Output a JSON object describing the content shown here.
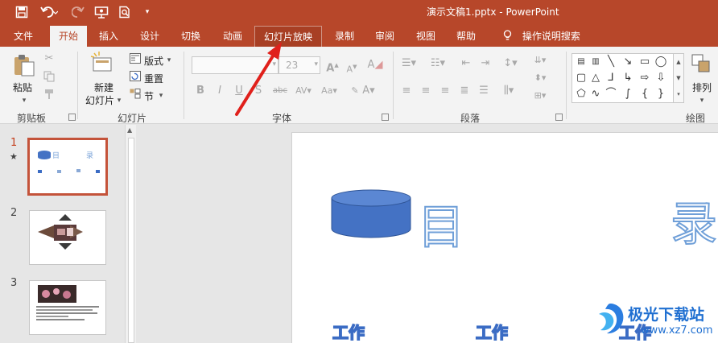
{
  "titlebar": {
    "document_title": "演示文稿1.pptx  -  PowerPoint",
    "quick_access": [
      "save-icon",
      "undo-icon",
      "redo-icon",
      "slideshow-from-start-icon",
      "print-preview-icon",
      "customize-qat-icon"
    ]
  },
  "tabs": [
    {
      "label": "文件"
    },
    {
      "label": "开始"
    },
    {
      "label": "插入"
    },
    {
      "label": "设计"
    },
    {
      "label": "切换"
    },
    {
      "label": "动画"
    },
    {
      "label": "幻灯片放映"
    },
    {
      "label": "录制"
    },
    {
      "label": "审阅"
    },
    {
      "label": "视图"
    },
    {
      "label": "帮助"
    },
    {
      "label": "操作说明搜索"
    }
  ],
  "ribbon": {
    "clipboard": {
      "paste": "粘贴",
      "group": "剪贴板"
    },
    "slides": {
      "new_slide_1": "新建",
      "new_slide_2": "幻灯片",
      "layout": "版式",
      "reset": "重置",
      "section": "节",
      "group": "幻灯片"
    },
    "font": {
      "font_size": "23",
      "group": "字体"
    },
    "paragraph": {
      "group": "段落"
    },
    "drawing": {
      "arrange": "排列",
      "group": "绘图"
    }
  },
  "thumbnails": [
    {
      "number": "1",
      "star": "★"
    },
    {
      "number": "2"
    },
    {
      "number": "3"
    }
  ],
  "slide": {
    "heading_left": "目",
    "heading_right": "录",
    "item_1": "工作",
    "item_2": "工作",
    "item_3": "工作",
    "shape_color": "#4472c4"
  },
  "annotation": {
    "arrow_color": "#e0201b"
  },
  "watermark": {
    "name": "极光下载站",
    "url": "www.xz7.com"
  },
  "colors": {
    "accent": "#b7472a",
    "active_tab_text": "#b7472a",
    "selection_border": "#c4533a"
  }
}
